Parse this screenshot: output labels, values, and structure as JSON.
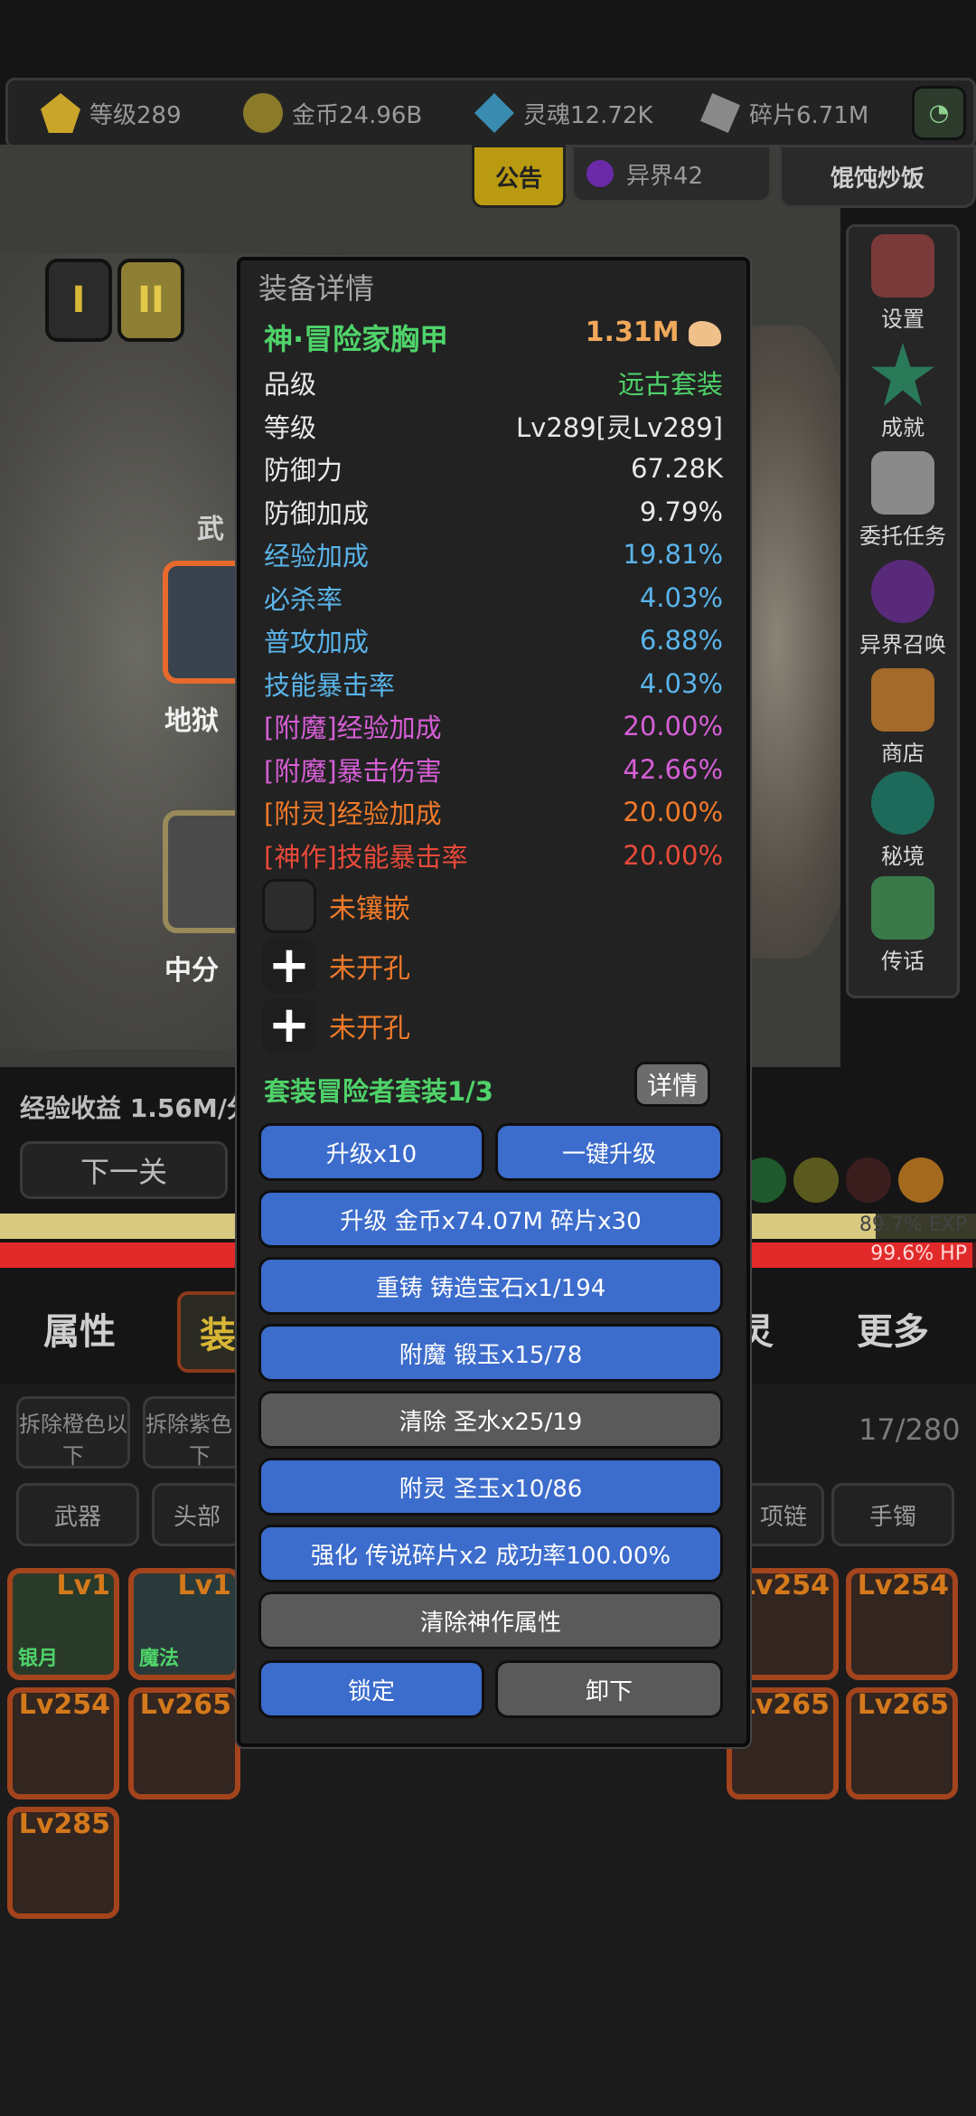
{
  "top_bar": {
    "level": "等级289",
    "gold": "金币24.96B",
    "soul": "灵魂12.72K",
    "shards": "碎片6.71M"
  },
  "top_tabs": {
    "notice": "公告",
    "realm": "异界42",
    "food": "馄饨炒饭"
  },
  "scene": {
    "roman_1": "I",
    "roman_2": "II",
    "left_label_1": "武",
    "left_label_2": "地狱",
    "left_label_3": "中分",
    "exp_income": "经验收益 1.56M/分",
    "next_stage": "下一关"
  },
  "right_menu": [
    {
      "label": "设置",
      "icon": "gear-icon"
    },
    {
      "label": "成就",
      "icon": "star-icon"
    },
    {
      "label": "委托任务",
      "icon": "scroll-icon"
    },
    {
      "label": "异界召唤",
      "icon": "portal-icon"
    },
    {
      "label": "商店",
      "icon": "shop-icon"
    },
    {
      "label": "秘境",
      "icon": "secret-realm-icon"
    },
    {
      "label": "传话",
      "icon": "horn-icon"
    }
  ],
  "bars": {
    "exp_label": "89.7% EXP",
    "hp_label": "99.6% HP",
    "exp_fraction": 0.897,
    "hp_fraction": 0.996
  },
  "bottom_tabs": [
    "属性",
    "装",
    "灵",
    "更多"
  ],
  "filters": {
    "orange": "拆除橙色以下",
    "purple": "拆除紫色以下",
    "count": "17/280"
  },
  "categories": [
    "武器",
    "头部",
    "项链",
    "手镯"
  ],
  "items": [
    {
      "lv": "Lv1",
      "tag": "银月"
    },
    {
      "lv": "Lv1",
      "tag": "魔法"
    },
    {
      "lv": "Lv254",
      "tag": ""
    },
    {
      "lv": "Lv254",
      "tag": ""
    },
    {
      "lv": "Lv254",
      "tag": ""
    },
    {
      "lv": "Lv265",
      "tag": ""
    },
    {
      "lv": "Lv265",
      "tag": ""
    },
    {
      "lv": "Lv265",
      "tag": ""
    },
    {
      "lv": "Lv285",
      "tag": ""
    }
  ],
  "modal": {
    "title": "装备详情",
    "name": "神·冒险家胸甲",
    "power": "1.31M",
    "stats": [
      {
        "label": "品级",
        "value": "远古套装",
        "label_color": "#e8e8e8",
        "value_color": "#4fd36a"
      },
      {
        "label": "等级",
        "value": "Lv289[灵Lv289]",
        "label_color": "#e8e8e8",
        "value_color": "#e8e8e8"
      },
      {
        "label": "防御力",
        "value": "67.28K",
        "label_color": "#e8e8e8",
        "value_color": "#e8e8e8"
      },
      {
        "label": "防御加成",
        "value": "9.79%",
        "label_color": "#e8e8e8",
        "value_color": "#e8e8e8"
      },
      {
        "label": "经验加成",
        "value": "19.81%",
        "label_color": "#5ab4ea",
        "value_color": "#5ab4ea"
      },
      {
        "label": "必杀率",
        "value": "4.03%",
        "label_color": "#5ab4ea",
        "value_color": "#5ab4ea"
      },
      {
        "label": "普攻加成",
        "value": "6.88%",
        "label_color": "#5ab4ea",
        "value_color": "#5ab4ea"
      },
      {
        "label": "技能暴击率",
        "value": "4.03%",
        "label_color": "#5ab4ea",
        "value_color": "#5ab4ea"
      },
      {
        "label": "[附魔]经验加成",
        "value": "20.00%",
        "label_color": "#d65fd6",
        "value_color": "#d65fd6"
      },
      {
        "label": "[附魔]暴击伤害",
        "value": "42.66%",
        "label_color": "#d65fd6",
        "value_color": "#d65fd6"
      },
      {
        "label": "[附灵]经验加成",
        "value": "20.00%",
        "label_color": "#f07a2a",
        "value_color": "#f07a2a"
      },
      {
        "label": "[神作]技能暴击率",
        "value": "20.00%",
        "label_color": "#ea4a3a",
        "value_color": "#ea4a3a"
      }
    ],
    "gems": [
      "未镶嵌",
      "未开孔",
      "未开孔"
    ],
    "set_text": "套装冒险者套装1/3",
    "detail_btn": "详情",
    "btn_upgrade10": "升级x10",
    "btn_oneclick": "一键升级",
    "btn_upgrade_cost": "升级 金币x74.07M 碎片x30",
    "btn_recast": "重铸 铸造宝石x1/194",
    "btn_enchant": "附魔 锻玉x15/78",
    "btn_clear": "清除 圣水x25/19",
    "btn_spirit": "附灵 圣玉x10/86",
    "btn_strengthen": "强化 传说碎片x2 成功率100.00%",
    "btn_clear_divine": "清除神作属性",
    "btn_lock": "锁定",
    "btn_unequip": "卸下"
  }
}
